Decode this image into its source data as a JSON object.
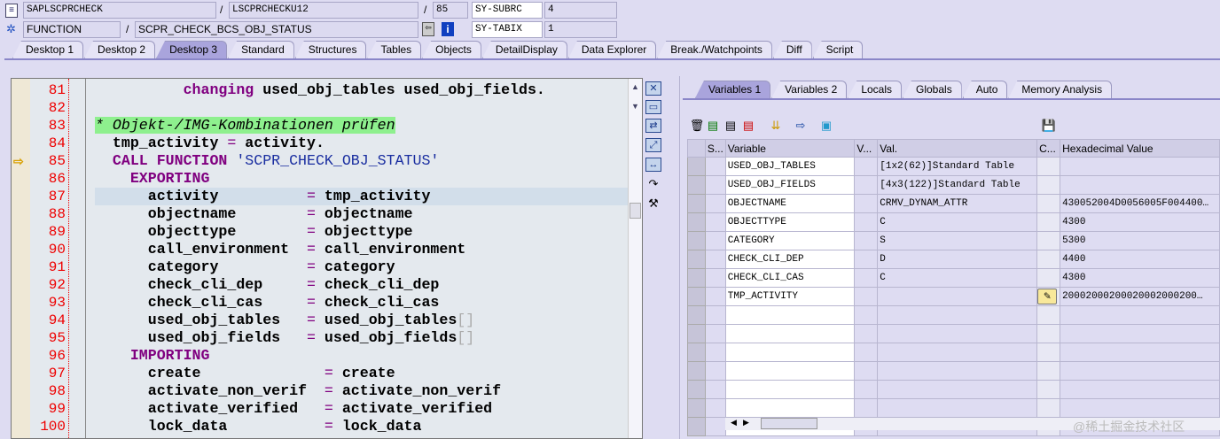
{
  "header": {
    "program": "SAPLSCPRCHECK",
    "include": "LSCPRCHECKU12",
    "line": "85",
    "sysfield1": "SY-SUBRC",
    "sysval1": "4",
    "event_type": "FUNCTION",
    "event": "SCPR_CHECK_BCS_OBJ_STATUS",
    "sysfield2": "SY-TABIX",
    "sysval2": "1",
    "sep": "/"
  },
  "main_tabs": [
    "Desktop 1",
    "Desktop 2",
    "Desktop 3",
    "Standard",
    "Structures",
    "Tables",
    "Objects",
    "DetailDisplay",
    "Data Explorer",
    "Break./Watchpoints",
    "Diff",
    "Script"
  ],
  "active_main_tab": 2,
  "code": [
    {
      "n": "81",
      "segs": [
        {
          "t": "          "
        },
        {
          "t": "changing",
          "c": "k"
        },
        {
          "t": " used_obj_tables used_obj_fields."
        }
      ]
    },
    {
      "n": "82",
      "segs": []
    },
    {
      "n": "83",
      "segs": [
        {
          "t": "* Objekt-/IMG-Kombinationen prüfen",
          "c": "c"
        }
      ]
    },
    {
      "n": "84",
      "segs": [
        {
          "t": "  tmp_activity "
        },
        {
          "t": "=",
          "c": "op"
        },
        {
          "t": " activity."
        }
      ]
    },
    {
      "n": "85",
      "segs": [
        {
          "t": "  "
        },
        {
          "t": "CALL FUNCTION",
          "c": "k"
        },
        {
          "t": " "
        },
        {
          "t": "'SCPR_CHECK_OBJ_STATUS'",
          "c": "s"
        }
      ],
      "current": true
    },
    {
      "n": "86",
      "segs": [
        {
          "t": "    "
        },
        {
          "t": "EXPORTING",
          "c": "k"
        }
      ]
    },
    {
      "n": "87",
      "segs": [
        {
          "t": "      activity          "
        },
        {
          "t": "=",
          "c": "op"
        },
        {
          "t": " tmp_activity"
        }
      ],
      "highlight": true
    },
    {
      "n": "88",
      "segs": [
        {
          "t": "      objectname        "
        },
        {
          "t": "=",
          "c": "op"
        },
        {
          "t": " objectname"
        }
      ]
    },
    {
      "n": "89",
      "segs": [
        {
          "t": "      objecttype        "
        },
        {
          "t": "=",
          "c": "op"
        },
        {
          "t": " objecttype"
        }
      ]
    },
    {
      "n": "90",
      "segs": [
        {
          "t": "      call_environment  "
        },
        {
          "t": "=",
          "c": "op"
        },
        {
          "t": " call_environment"
        }
      ]
    },
    {
      "n": "91",
      "segs": [
        {
          "t": "      category          "
        },
        {
          "t": "=",
          "c": "op"
        },
        {
          "t": " category"
        }
      ]
    },
    {
      "n": "92",
      "segs": [
        {
          "t": "      check_cli_dep     "
        },
        {
          "t": "=",
          "c": "op"
        },
        {
          "t": " check_cli_dep"
        }
      ]
    },
    {
      "n": "93",
      "segs": [
        {
          "t": "      check_cli_cas     "
        },
        {
          "t": "=",
          "c": "op"
        },
        {
          "t": " check_cli_cas"
        }
      ]
    },
    {
      "n": "94",
      "segs": [
        {
          "t": "      used_obj_tables   "
        },
        {
          "t": "=",
          "c": "op"
        },
        {
          "t": " used_obj_tables"
        },
        {
          "t": "[]",
          "c": "g"
        }
      ]
    },
    {
      "n": "95",
      "segs": [
        {
          "t": "      used_obj_fields   "
        },
        {
          "t": "=",
          "c": "op"
        },
        {
          "t": " used_obj_fields"
        },
        {
          "t": "[]",
          "c": "g"
        }
      ]
    },
    {
      "n": "96",
      "segs": [
        {
          "t": "    "
        },
        {
          "t": "IMPORTING",
          "c": "k"
        }
      ]
    },
    {
      "n": "97",
      "segs": [
        {
          "t": "      create              "
        },
        {
          "t": "=",
          "c": "op"
        },
        {
          "t": " create"
        }
      ]
    },
    {
      "n": "98",
      "segs": [
        {
          "t": "      activate_non_verif  "
        },
        {
          "t": "=",
          "c": "op"
        },
        {
          "t": " activate_non_verif"
        }
      ]
    },
    {
      "n": "99",
      "segs": [
        {
          "t": "      activate_verified   "
        },
        {
          "t": "=",
          "c": "op"
        },
        {
          "t": " activate_verified"
        }
      ]
    },
    {
      "n": "100",
      "segs": [
        {
          "t": "      lock_data           "
        },
        {
          "t": "=",
          "c": "op"
        },
        {
          "t": " lock_data"
        }
      ]
    }
  ],
  "var_tabs": [
    "Variables 1",
    "Variables 2",
    "Locals",
    "Globals",
    "Auto",
    "Memory Analysis"
  ],
  "columns": [
    "S...",
    "Variable",
    "V...",
    "Val.",
    "C...",
    "Hexadecimal Value"
  ],
  "rows": [
    {
      "var": "USED_OBJ_TABLES",
      "val": "[1x2(62)]Standard Table",
      "hex": ""
    },
    {
      "var": "USED_OBJ_FIELDS",
      "val": "[4x3(122)]Standard Table",
      "hex": ""
    },
    {
      "var": "OBJECTNAME",
      "val": "CRMV_DYNAM_ATTR",
      "hex": "430052004D0056005F004400…"
    },
    {
      "var": "OBJECTTYPE",
      "val": "C",
      "hex": "4300"
    },
    {
      "var": "CATEGORY",
      "val": "S",
      "hex": "5300"
    },
    {
      "var": "CHECK_CLI_DEP",
      "val": "D",
      "hex": "4400"
    },
    {
      "var": "CHECK_CLI_CAS",
      "val": "C",
      "hex": "4300"
    },
    {
      "var": "TMP_ACTIVITY",
      "val": "",
      "hex": "20002000200020002000200…",
      "edit": true
    }
  ],
  "empty_rows": 7,
  "watermark": "@稀土掘金技术社区"
}
